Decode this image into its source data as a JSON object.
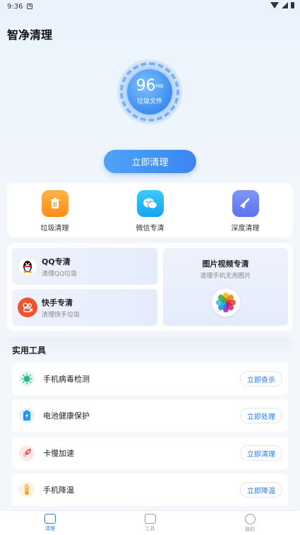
{
  "status_bar": {
    "time": "9:36"
  },
  "app_title": "智净清理",
  "gauge": {
    "value": "96",
    "unit": "MB",
    "label": "垃圾文件"
  },
  "clean_button": "立即清理",
  "quick_actions": [
    {
      "label": "垃圾清理",
      "icon": "trash-icon",
      "color": "#ff9b2e"
    },
    {
      "label": "微信专清",
      "icon": "wechat-icon",
      "color": "#1fb6f5"
    },
    {
      "label": "深度清理",
      "icon": "broom-icon",
      "color": "#6a84f5"
    }
  ],
  "special": {
    "qq": {
      "title": "QQ专清",
      "subtitle": "清理QQ垃圾"
    },
    "kuaishou": {
      "title": "快手专清",
      "subtitle": "清理快手垃圾"
    },
    "photo": {
      "title": "图片视频专清",
      "subtitle": "清理手机无用图片"
    }
  },
  "tools": {
    "title": "实用工具",
    "items": [
      {
        "label": "手机病毒检测",
        "button": "立即查杀",
        "icon": "virus-icon",
        "color": "#2bb58a"
      },
      {
        "label": "电池健康保护",
        "button": "立即处理",
        "icon": "battery-icon",
        "color": "#2196f3"
      },
      {
        "label": "卡慢加速",
        "button": "立即清理",
        "icon": "rocket-icon",
        "color": "#f25b5b"
      },
      {
        "label": "手机降温",
        "button": "立即降温",
        "icon": "thermometer-icon",
        "color": "#f0a020"
      }
    ]
  },
  "nav": [
    {
      "label": "清理",
      "icon": "broom-nav-icon",
      "active": true
    },
    {
      "label": "工具",
      "icon": "toolbox-icon",
      "active": false
    },
    {
      "label": "我的",
      "icon": "user-icon",
      "active": false
    }
  ]
}
